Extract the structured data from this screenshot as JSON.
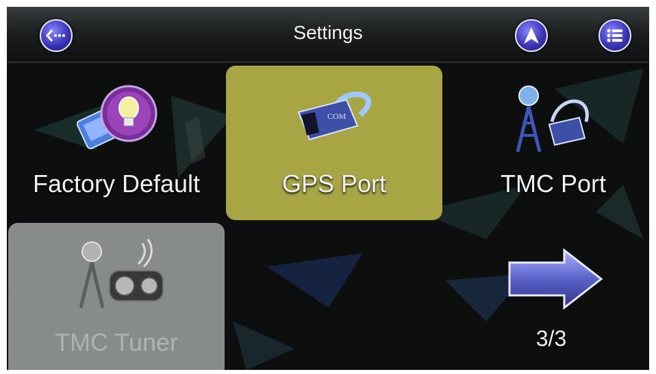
{
  "header": {
    "title": "Settings",
    "back_icon": "back-icon",
    "nav_icon": "navigation-arrow-icon",
    "menu_icon": "menu-list-icon"
  },
  "tiles": [
    {
      "label": "Factory Default",
      "icon": "factory-default-icon",
      "state": "normal"
    },
    {
      "label": "GPS Port",
      "icon": "gps-port-icon",
      "state": "selected"
    },
    {
      "label": "TMC Port",
      "icon": "tmc-port-icon",
      "state": "normal"
    },
    {
      "label": "TMC Tuner",
      "icon": "tmc-tuner-icon",
      "state": "disabled"
    }
  ],
  "pager": {
    "page": "3/3",
    "next_icon": "next-page-arrow-icon"
  },
  "colors": {
    "selected_tile": "#a8a545",
    "disabled_tile": "#8f9292",
    "button_blue": "#3b35b8",
    "arrow_blue": "#5a62c9"
  }
}
